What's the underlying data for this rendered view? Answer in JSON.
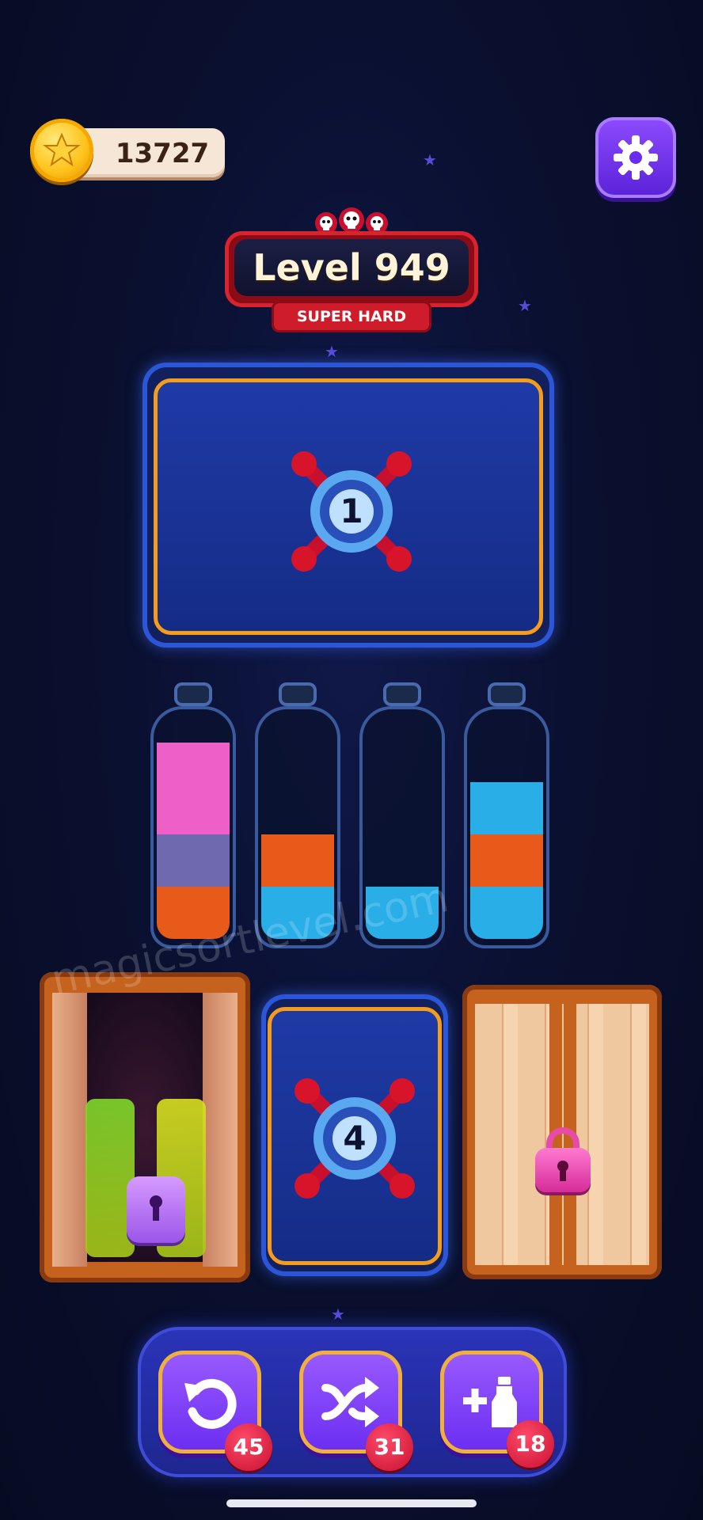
{
  "coins": {
    "value": "13727",
    "icon": "star-coin-icon"
  },
  "settings": {
    "icon": "gear-icon"
  },
  "level": {
    "title": "Level 949",
    "difficulty": "SUPER HARD",
    "icon": "skulls-icon"
  },
  "locked_slots": [
    {
      "unlock_number": "1",
      "icon": "pin-lock-icon"
    },
    {
      "unlock_number": "4",
      "icon": "pin-lock-icon"
    }
  ],
  "bottles": [
    {
      "layers_bottom_to_top": [
        "#e85a1a",
        "#6f6ab0",
        "#ef5fc8"
      ]
    },
    {
      "layers_bottom_to_top": [
        "#2aaee8",
        "#e85a1a"
      ]
    },
    {
      "layers_bottom_to_top": [
        "#2aaee8"
      ]
    },
    {
      "layers_bottom_to_top": [
        "#2aaee8",
        "#e85a1a",
        "#2aaee8"
      ]
    }
  ],
  "closets": [
    {
      "state": "open",
      "lock_icon": "purple-lock-icon",
      "bottle_colors": [
        "#7fd82a",
        "#d8e020"
      ]
    },
    {
      "state": "closed",
      "lock_icon": "pink-lock-icon"
    }
  ],
  "tools": [
    {
      "name": "undo",
      "icon": "undo-icon",
      "count": "45"
    },
    {
      "name": "shuffle",
      "icon": "shuffle-icon",
      "count": "31"
    },
    {
      "name": "add-bottle",
      "icon": "add-bottle-icon",
      "count": "18"
    }
  ],
  "watermark": "magicsortlevel.com"
}
